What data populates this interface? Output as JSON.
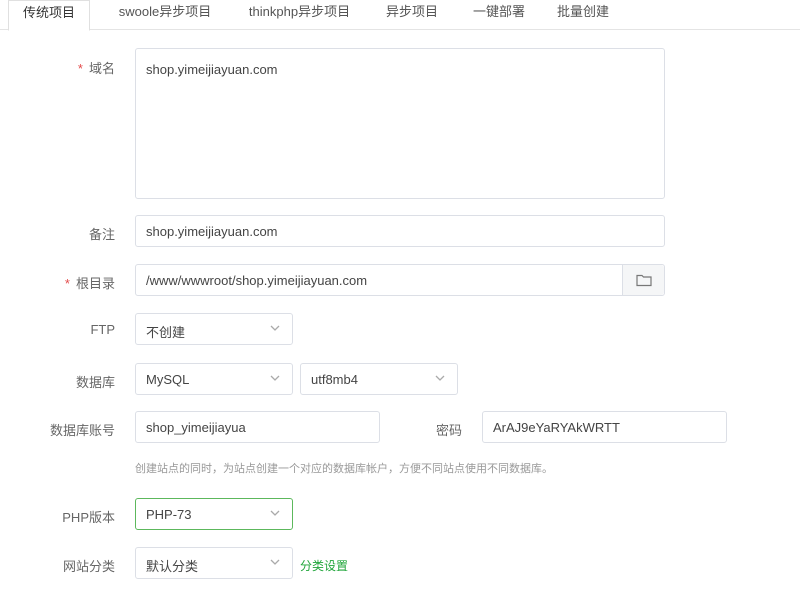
{
  "tabs": [
    {
      "label": "传统项目",
      "active": true
    },
    {
      "label": "swoole异步项目",
      "active": false
    },
    {
      "label": "thinkphp异步项目",
      "active": false
    },
    {
      "label": "异步项目",
      "active": false
    },
    {
      "label": "一键部署",
      "active": false
    },
    {
      "label": "批量创建",
      "active": false
    }
  ],
  "form": {
    "domain": {
      "label": "域名",
      "required_mark": "*",
      "value": "shop.yimeijiayuan.com"
    },
    "remark": {
      "label": "备注",
      "value": "shop.yimeijiayuan.com"
    },
    "root": {
      "label": "根目录",
      "required_mark": "*",
      "value": "/www/wwwroot/shop.yimeijiayuan.com",
      "button_icon": "folder-icon"
    },
    "ftp": {
      "label": "FTP",
      "value": "不创建"
    },
    "database": {
      "label": "数据库",
      "type_value": "MySQL",
      "charset_value": "utf8mb4"
    },
    "db_account": {
      "label": "数据库账号",
      "value": "shop_yimeijiayua",
      "password_label": "密码",
      "password_value": "ArAJ9eYaRYAkWRTT"
    },
    "db_hint": "创建站点的同时，为站点创建一个对应的数据库帐户，方便不同站点使用不同数据库。",
    "php": {
      "label": "PHP版本",
      "value": "PHP-73"
    },
    "category": {
      "label": "网站分类",
      "value": "默认分类",
      "link": "分类设置"
    }
  },
  "colors": {
    "accent": "#20a53a",
    "required": "#e34b4b",
    "border": "#dcdfe6"
  }
}
